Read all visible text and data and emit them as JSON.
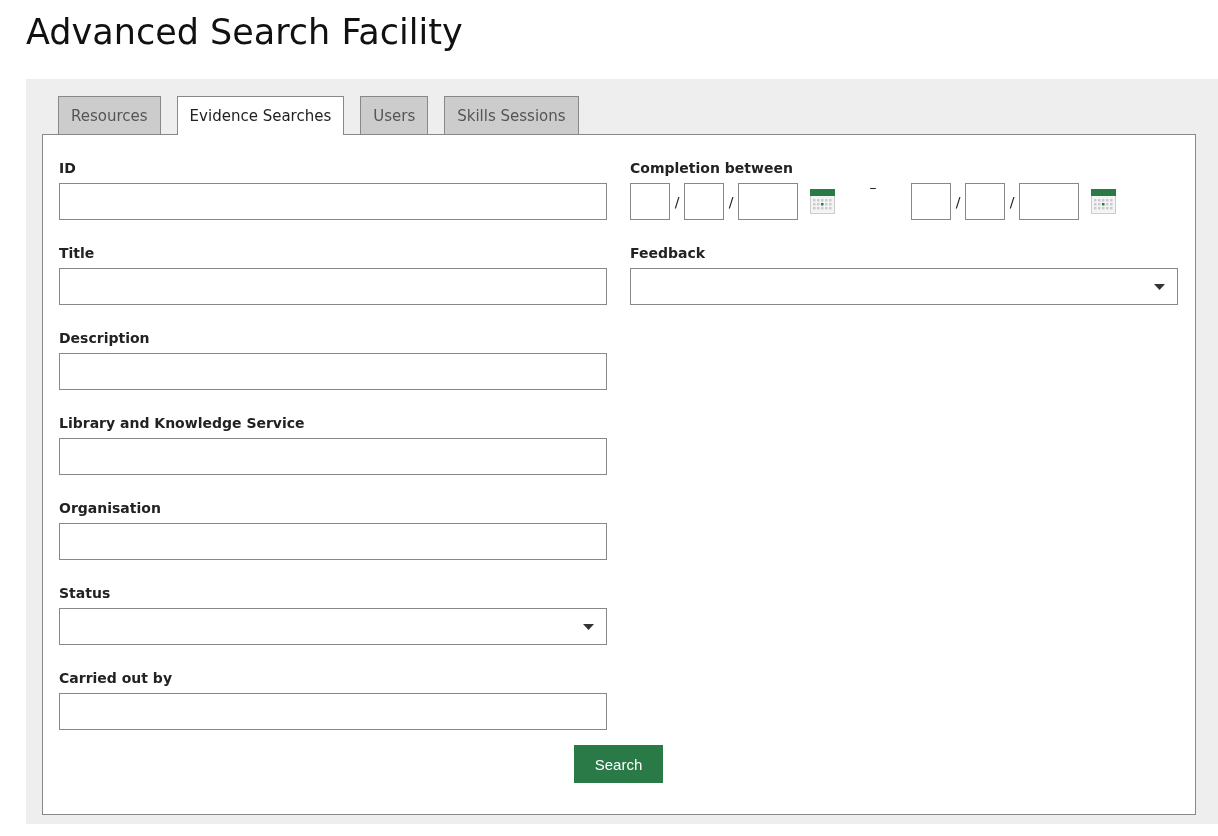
{
  "page_title": "Advanced Search Facility",
  "tabs": [
    {
      "label": "Resources",
      "selected": false
    },
    {
      "label": "Evidence Searches",
      "selected": true
    },
    {
      "label": "Users",
      "selected": false
    },
    {
      "label": "Skills Sessions",
      "selected": false
    }
  ],
  "left_fields": [
    {
      "label": "ID",
      "kind": "text"
    },
    {
      "label": "Title",
      "kind": "text"
    },
    {
      "label": "Description",
      "kind": "text"
    },
    {
      "label": "Library and Knowledge Service",
      "kind": "text"
    },
    {
      "label": "Organisation",
      "kind": "text"
    },
    {
      "label": "Status",
      "kind": "select"
    },
    {
      "label": "Carried out by",
      "kind": "text"
    }
  ],
  "right_fields": [
    {
      "label": "Completion between",
      "kind": "daterange",
      "from_separators": [
        "/",
        "/"
      ],
      "range_separator": "–",
      "to_separators": [
        "/",
        "/"
      ]
    },
    {
      "label": "Feedback",
      "kind": "select"
    }
  ],
  "search_button": "Search"
}
